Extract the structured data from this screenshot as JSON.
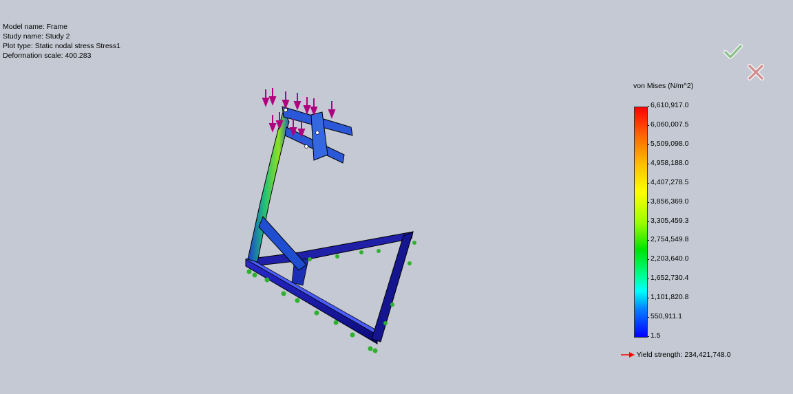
{
  "info": {
    "model_name": "Model name: Frame",
    "study_name": "Study name: Study 2",
    "plot_type": "Plot type: Static nodal stress Stress1",
    "deformation_scale": "Deformation scale: 400.283"
  },
  "buttons": {
    "ok_icon": "check-icon",
    "cancel_icon": "close-icon"
  },
  "legend": {
    "title": "von Mises (N/m^2)",
    "ticks": [
      "6,610,917.0",
      "6,060,007.5",
      "5,509,098.0",
      "4,958,188.0",
      "4,407,278.5",
      "3,856,369.0",
      "3,305,459.3",
      "2,754,549.8",
      "2,203,640.0",
      "1,652,730.4",
      "1,101,820.8",
      "550,911.1",
      "1.5"
    ],
    "yield": "Yield strength: 234,421,748.0"
  },
  "colors": {
    "background": "#c5c9d3",
    "arrow_red": "#ff0000",
    "load_arrows": "#b0007f",
    "fixtures": "#2fb02f"
  }
}
